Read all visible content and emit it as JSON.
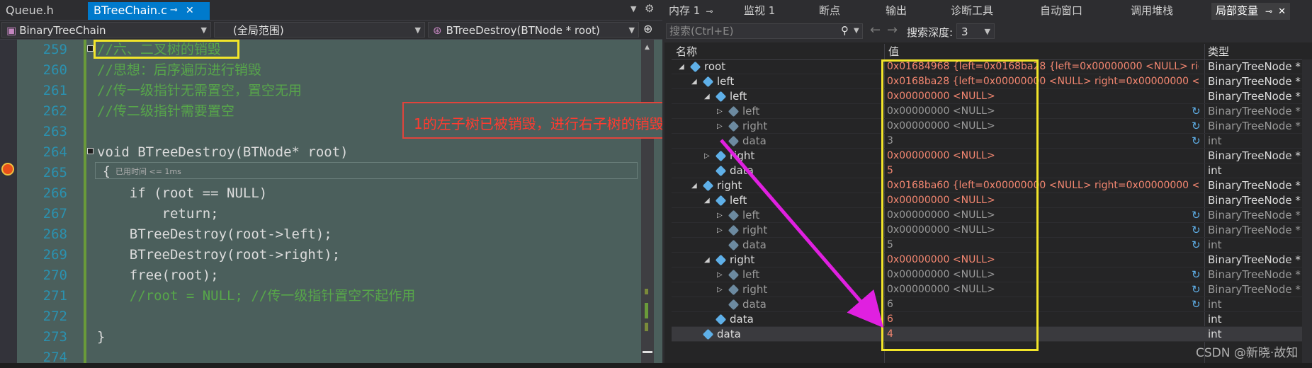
{
  "editor": {
    "tabs": [
      {
        "label": "Queue.h"
      },
      {
        "label": "BTreeChain.c"
      }
    ],
    "tab_pin": "⊸",
    "tab_close": "✕",
    "nav": {
      "project": "BinaryTreeChain",
      "scope": "(全局范围)",
      "function": "BTreeDestroy(BTNode * root)"
    },
    "lines": [
      {
        "no": "259",
        "text": "//六、二叉树的销毁",
        "kind": "comment"
      },
      {
        "no": "260",
        "text": "//思想：后序遍历进行销毁",
        "kind": "comment"
      },
      {
        "no": "261",
        "text": "//传一级指针无需置空，置空无用",
        "kind": "comment"
      },
      {
        "no": "262",
        "text": "//传二级指针需要置空",
        "kind": "comment"
      },
      {
        "no": "263",
        "text": "",
        "kind": "blank"
      },
      {
        "no": "264",
        "text": "void BTreeDestroy(BTNode* root)",
        "kind": "code"
      },
      {
        "no": "265",
        "text": "{",
        "kind": "code"
      },
      {
        "no": "266",
        "text": "    if (root == NULL)",
        "kind": "code"
      },
      {
        "no": "267",
        "text": "        return;",
        "kind": "code"
      },
      {
        "no": "268",
        "text": "    BTreeDestroy(root->left);",
        "kind": "code"
      },
      {
        "no": "269",
        "text": "    BTreeDestroy(root->right);",
        "kind": "code"
      },
      {
        "no": "270",
        "text": "    free(root);",
        "kind": "code"
      },
      {
        "no": "271",
        "text": "    //root = NULL; //传一级指针置空不起作用",
        "kind": "comment"
      },
      {
        "no": "272",
        "text": "",
        "kind": "blank"
      },
      {
        "no": "273",
        "text": "}",
        "kind": "code"
      },
      {
        "no": "274",
        "text": "",
        "kind": "blank"
      }
    ],
    "perf_tip": "已用时间 <= 1ms",
    "annotation": "1的左子树已被销毁，进行右子树的销毁！"
  },
  "debug": {
    "tabs": [
      {
        "label": "内存 1"
      },
      {
        "label": "监视 1"
      },
      {
        "label": "断点"
      },
      {
        "label": "输出"
      },
      {
        "label": "诊断工具"
      },
      {
        "label": "自动窗口"
      },
      {
        "label": "调用堆栈"
      },
      {
        "label": "局部变量"
      }
    ],
    "search_placeholder": "搜索(Ctrl+E)",
    "search_depth_label": "搜索深度:",
    "search_depth_value": "3",
    "columns": {
      "name": "名称",
      "value": "值",
      "type": "类型"
    },
    "rows": [
      {
        "level": 0,
        "expander": "open",
        "name": "root",
        "value": "0x01684968 {left=0x0168ba28 {left=0x00000000 <NULL> right=0...",
        "type": "BinaryTreeNode *",
        "dim": false,
        "refresh": false
      },
      {
        "level": 1,
        "expander": "open",
        "name": "left",
        "value": "0x0168ba28 {left=0x00000000 <NULL> right=0x00000000 <NULL...",
        "type": "BinaryTreeNode *",
        "dim": false,
        "refresh": false
      },
      {
        "level": 2,
        "expander": "open",
        "name": "left",
        "value": "0x00000000 <NULL>",
        "type": "BinaryTreeNode *",
        "dim": false,
        "refresh": false
      },
      {
        "level": 3,
        "expander": "closed",
        "name": "left",
        "value": "0x00000000 <NULL>",
        "type": "BinaryTreeNode *",
        "dim": true,
        "refresh": true
      },
      {
        "level": 3,
        "expander": "closed",
        "name": "right",
        "value": "0x00000000 <NULL>",
        "type": "BinaryTreeNode *",
        "dim": true,
        "refresh": true
      },
      {
        "level": 3,
        "expander": "none",
        "name": "data",
        "value": "3",
        "type": "int",
        "dim": true,
        "refresh": true
      },
      {
        "level": 2,
        "expander": "closed",
        "name": "right",
        "value": "0x00000000 <NULL>",
        "type": "BinaryTreeNode *",
        "dim": false,
        "refresh": false
      },
      {
        "level": 2,
        "expander": "none",
        "name": "data",
        "value": "5",
        "type": "int",
        "dim": false,
        "refresh": false
      },
      {
        "level": 1,
        "expander": "open",
        "name": "right",
        "value": "0x0168ba60 {left=0x00000000 <NULL> right=0x00000000 <NULL...",
        "type": "BinaryTreeNode *",
        "dim": false,
        "refresh": false
      },
      {
        "level": 2,
        "expander": "open",
        "name": "left",
        "value": "0x00000000 <NULL>",
        "type": "BinaryTreeNode *",
        "dim": false,
        "refresh": false
      },
      {
        "level": 3,
        "expander": "closed",
        "name": "left",
        "value": "0x00000000 <NULL>",
        "type": "BinaryTreeNode *",
        "dim": true,
        "refresh": true
      },
      {
        "level": 3,
        "expander": "closed",
        "name": "right",
        "value": "0x00000000 <NULL>",
        "type": "BinaryTreeNode *",
        "dim": true,
        "refresh": true
      },
      {
        "level": 3,
        "expander": "none",
        "name": "data",
        "value": "5",
        "type": "int",
        "dim": true,
        "refresh": true
      },
      {
        "level": 2,
        "expander": "open",
        "name": "right",
        "value": "0x00000000 <NULL>",
        "type": "BinaryTreeNode *",
        "dim": false,
        "refresh": false
      },
      {
        "level": 3,
        "expander": "closed",
        "name": "left",
        "value": "0x00000000 <NULL>",
        "type": "BinaryTreeNode *",
        "dim": true,
        "refresh": true
      },
      {
        "level": 3,
        "expander": "closed",
        "name": "right",
        "value": "0x00000000 <NULL>",
        "type": "BinaryTreeNode *",
        "dim": true,
        "refresh": true
      },
      {
        "level": 3,
        "expander": "none",
        "name": "data",
        "value": "6",
        "type": "int",
        "dim": true,
        "refresh": true
      },
      {
        "level": 2,
        "expander": "none",
        "name": "data",
        "value": "6",
        "type": "int",
        "dim": false,
        "refresh": false
      },
      {
        "level": 1,
        "expander": "none",
        "name": "data",
        "value": "4",
        "type": "int",
        "dim": false,
        "refresh": false
      }
    ],
    "watermark": "CSDN @新晓·故知"
  },
  "colors": {
    "accent": "#007acc",
    "annotation_red": "#e0443c",
    "highlight_yellow": "#f2e52a",
    "arrow_magenta": "#e020e0",
    "value_red": "#f48771"
  }
}
